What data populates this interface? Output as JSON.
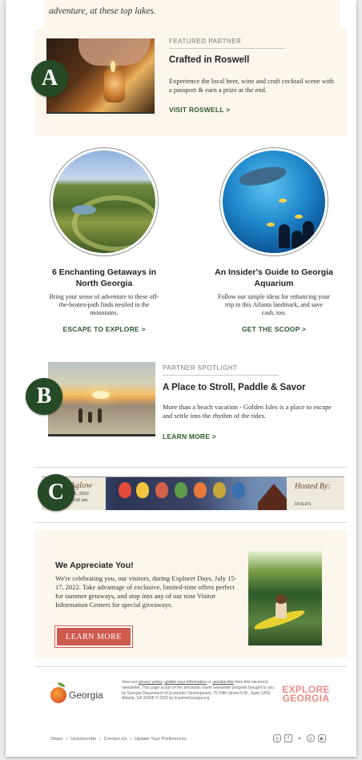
{
  "intro": {
    "text": "adventure, at these top lakes."
  },
  "featured": {
    "label": "FEATURED PARTNER",
    "title": "Crafted in Roswell",
    "description": "Experience the local beer, wine and craft cocktail scene with a passport & earn a prize at the end.",
    "cta": "VISIT ROSWELL >",
    "badge": "A"
  },
  "columns": [
    {
      "title": "6 Enchanting Getaways in North Georgia",
      "description": "Bring your sense of adventure to these off-the-beaten-path finds nestled in the mountains.",
      "cta": "ESCAPE TO EXPLORE >"
    },
    {
      "title": "An Insider's Guide to Georgia Aquarium",
      "description": "Follow our simple ideas for enhancing your trip to this Atlanta landmark, and save cash, too.",
      "cta": "GET THE SCOOP >"
    }
  ],
  "spotlight": {
    "label": "PARTNER SPOTLIGHT",
    "title": "A Place to Stroll, Paddle & Savor",
    "description": "More than a beach vacation - Golden Isles is a place to escape and settle into the rhythm of the tides.",
    "cta": "LEARN MORE >",
    "badge": "B"
  },
  "banner": {
    "left_script": "tts Aglow",
    "left_date": "August 6, 2022",
    "left_time": "7pm-10:00 pm",
    "right_script": "Hosted By:",
    "right_small": "RIVERS",
    "badge": "C"
  },
  "appreciate": {
    "title": "We Appreciate You!",
    "description": "We're celebrating you, our visitors, during Explorer Days, July 15-17, 2022. Take advantage of exclusive, limited-time offers perfect for summer getaways, and stop into any of our nine Visitor Information Centers for special giveaways.",
    "button": "LEARN MORE"
  },
  "footer": {
    "logo_text": "Georgia",
    "legal_prefix": "View our",
    "privacy_link": "privacy policy",
    "update_link": "update your information",
    "or_text": "or",
    "unsubscribe_link": "unsubscribe",
    "legal_body": "from this electronic newsletter. This page is part of the electronic travel newsletter program brought to you by Georgia Department of Economic Development, 75 Fifth Street N.W., Suite 1200, Atlanta, GA 30308 © 2022 by ExploreGeorgia.org",
    "explore_line1": "EXPLORE",
    "explore_line2": "GEORGIA",
    "links": [
      "Share",
      "Unsubscribe",
      "Contact Us",
      "Update Your Preferences"
    ],
    "social": [
      "instagram-icon",
      "facebook-icon",
      "twitter-icon",
      "pinterest-icon",
      "youtube-icon"
    ]
  },
  "colors": {
    "cream": "#fdf6ed",
    "cta_green": "#2f5a2c",
    "badge_green": "#264a26",
    "button_red": "#cf5a4e",
    "explore_pink": "#e98b86"
  }
}
